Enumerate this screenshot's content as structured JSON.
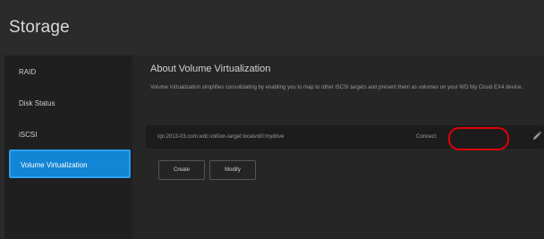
{
  "page": {
    "title": "Storage"
  },
  "sidebar": {
    "items": [
      {
        "label": "RAID"
      },
      {
        "label": "Disk Status"
      },
      {
        "label": "iSCSI"
      },
      {
        "label": "Volume Virtualization",
        "selected": true
      }
    ]
  },
  "main": {
    "section_title": "About Volume Virtualization",
    "description": "Volume Virtualization simplifies consolidating by enabling you to map to other iSCSI targets and present them as volumes on your WD My Cloud EX4 device.",
    "volume": {
      "path": "iqn.2013-03.com.wdc:vol0on-target:localvol0:mydrive",
      "status": "Connect"
    },
    "buttons": {
      "create": "Create",
      "modify": "Modify"
    }
  },
  "colors": {
    "accent": "#1385d4",
    "highlight": "#e0000a",
    "background": "#2a2a2a"
  },
  "icons": {
    "edit": "pencil-icon"
  }
}
